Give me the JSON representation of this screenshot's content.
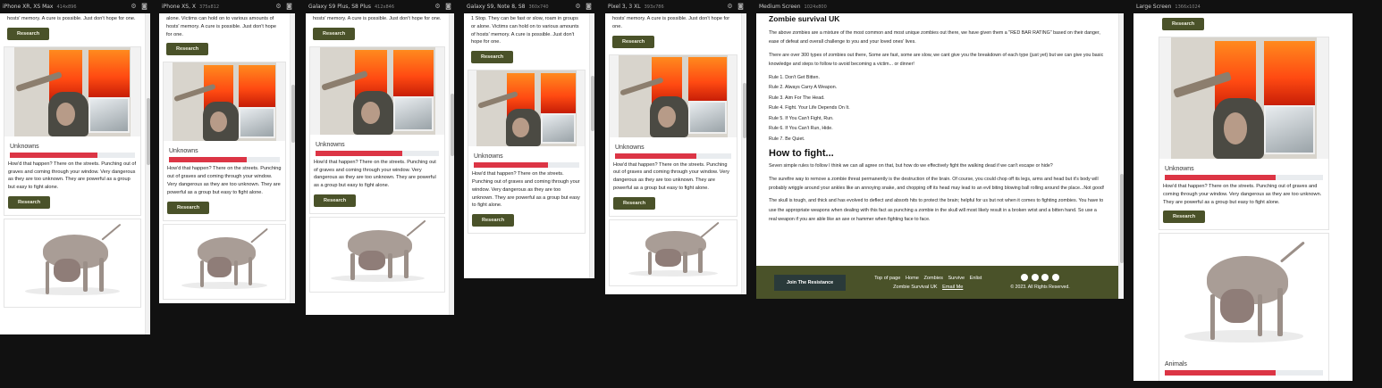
{
  "texts": {
    "zombie_blurb": "hosts' memory. A cure is possible. Just don't hope for one.",
    "zombie_blurb_long": "alone. Victims can hold on to various amounts of hosts' memory. A cure is possible. Just don't hope for one.",
    "zombie_blurb_s5": "1 Stop. They can be fast or slow, roam in groups or alone. Victims can hold on to various amounts of hosts' memory. A cure is possible. Just don't hope for one.",
    "unknowns_title": "Unknowns",
    "unknowns_desc": "How'd that happen? There on the streets. Punching out of graves and coming through your window. Very dangerous as they are too unknown. They are powerful as a group but easy to fight alone.",
    "animals_title": "Animals",
    "research_label": "Research"
  },
  "devices": [
    {
      "label": "iPhone XR, XS Max",
      "dims": "414x896"
    },
    {
      "label": "iPhone XS, X",
      "dims": "375x812"
    },
    {
      "label": "Galaxy S9 Plus, S8 Plus",
      "dims": "412x846"
    },
    {
      "label": "Galaxy S9, Note 8, S8",
      "dims": "360x740"
    },
    {
      "label": "Pixel 3, 3 XL",
      "dims": "393x786"
    },
    {
      "label": "Medium Screen",
      "dims": "1024x800"
    },
    {
      "label": "Large Screen",
      "dims": "1366x1024"
    }
  ],
  "bar_levels": {
    "unknowns": 0.7
  },
  "medium": {
    "site_title": "Zombie survival UK",
    "intro": "The above zombies are a mixture of the most common and most unique zombies out there, we have given them a \"RED BAR RATING\" based on their danger, ease of defeat and overall challenge to you and your loved ones' lives.",
    "intro2": "There are over 300 types of zombies out there, Some are fast, some are slow, we cant give you the breakdown of each type (just yet) but we can give you basic knowledge and steps to follow to avoid becoming a victim... or dinner!",
    "rules": [
      "Rule 1. Don't Get Bitten.",
      "Rule 2. Always Carry A Weapon.",
      "Rule 3. Aim For The Head.",
      "Rule 4. Fight. Your Life Depends On It.",
      "Rule 5. If You Can't Fight, Run.",
      "Rule 6. If You Can't Run, Hide.",
      "Rule 7. Be Quiet."
    ],
    "fight_heading": "How to fight...",
    "fight_p1": "Seven simple rules to follow I think we can all agree on that, but how do we effectively fight the walking dead if we can't escape or hide?",
    "fight_p2": "The surefire way to remove a zombie threat permanently is the destruction of the brain. Of course, you could chop off its legs, arms and head but it's body will probably wriggle around your ankles like an annoying snake, and chopping off its head may lead to an evil biting blowing ball rolling around the place...Not good!",
    "fight_p3": "The skull is tough, and thick and has evolved to deflect and absorb hits to protect the brain; helpful for us but not when it comes to fighting zombies. You have to use the appropriate weapons when dealing with this fact as punching a zombie in the skull will most likely result in a broken wrist and a bitten hand. So use a real weapon if you are able like an axe or hammer when fighting face to face.",
    "footer": {
      "join_label": "Join The Resistance",
      "nav": [
        "Top of page",
        "Home",
        "Zombies",
        "Survive",
        "Enlist"
      ],
      "brand": "Zombie Survival UK",
      "email": "Email Me",
      "copyright": "© 2023. All Rights Reserved."
    }
  },
  "colors": {
    "accent": "#4a5229",
    "danger_bar": "#dc3545",
    "background": "#111111"
  }
}
